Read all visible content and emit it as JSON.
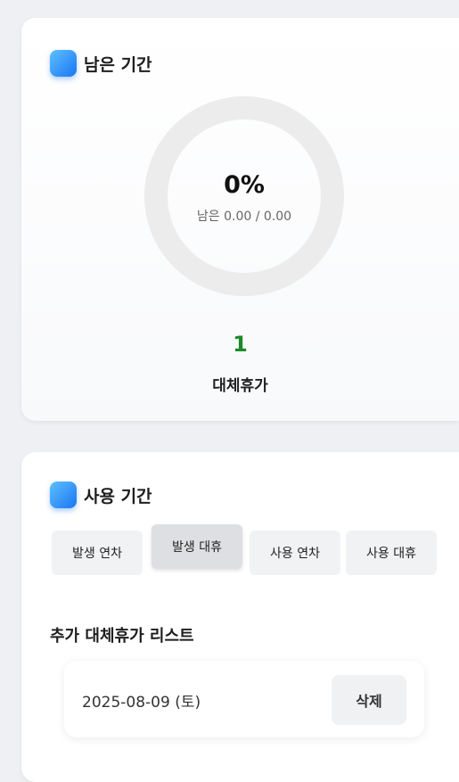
{
  "remaining": {
    "title": "남은 기간",
    "percent_label": "0%",
    "percent": 0,
    "remaining_text": "남은 0.00 / 0.00",
    "count": "1",
    "count_label": "대체휴가"
  },
  "usage": {
    "title": "사용 기간",
    "tabs": [
      {
        "label": "발생 연차",
        "active": false
      },
      {
        "label": "발생 대휴",
        "active": true
      },
      {
        "label": "사용 연차",
        "active": false
      },
      {
        "label": "사용 대휴",
        "active": false
      }
    ],
    "list_title": "추가 대체휴가 리스트",
    "items": [
      {
        "date": "2025-08-09 (토)",
        "delete_label": "삭제"
      }
    ]
  },
  "colors": {
    "accent_blue": "#1976f2",
    "count_green": "#1a8a2a",
    "donut_track": "#ececec"
  }
}
